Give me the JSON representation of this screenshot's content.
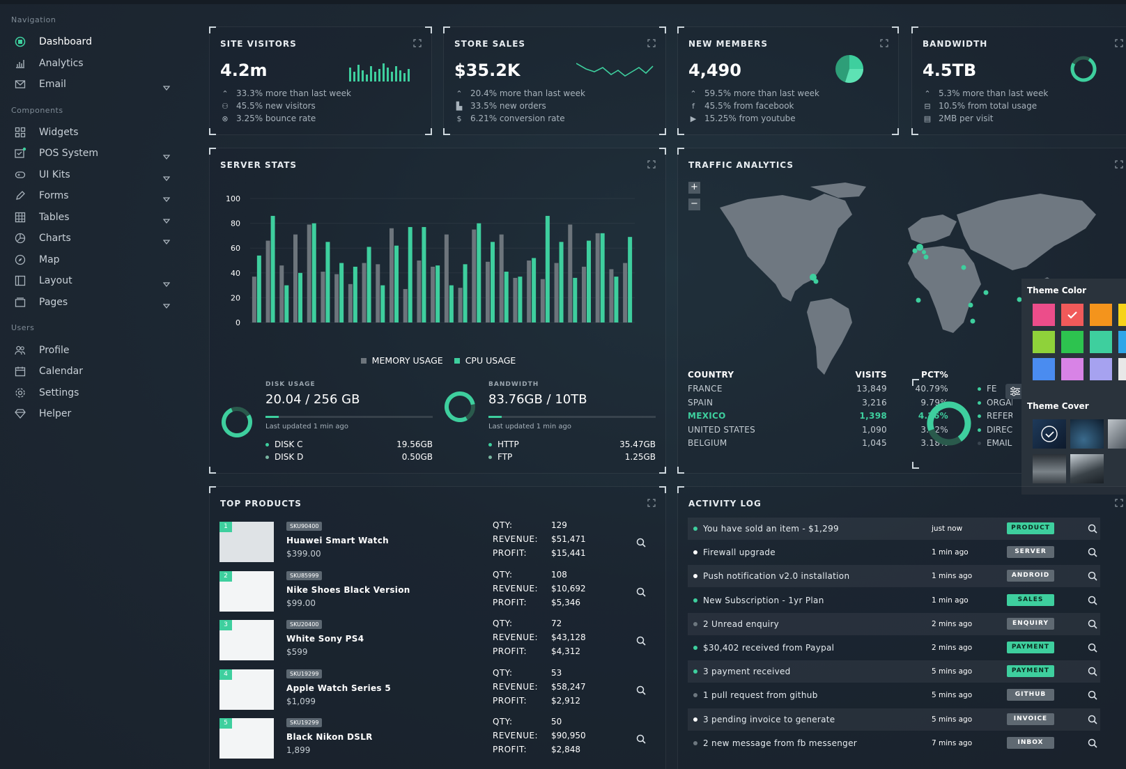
{
  "nav": {
    "section_navigation": "Navigation",
    "section_components": "Components",
    "section_users": "Users",
    "items": [
      {
        "label": "Dashboard"
      },
      {
        "label": "Analytics"
      },
      {
        "label": "Email"
      },
      {
        "label": "Widgets"
      },
      {
        "label": "POS System"
      },
      {
        "label": "UI Kits"
      },
      {
        "label": "Forms"
      },
      {
        "label": "Tables"
      },
      {
        "label": "Charts"
      },
      {
        "label": "Map"
      },
      {
        "label": "Layout"
      },
      {
        "label": "Pages"
      },
      {
        "label": "Profile"
      },
      {
        "label": "Calendar"
      },
      {
        "label": "Settings"
      },
      {
        "label": "Helper"
      }
    ]
  },
  "kpis": [
    {
      "title": "SITE VISITORS",
      "value": "4.2m",
      "lines": [
        "33.3% more than last week",
        "45.5% new visitors",
        "3.25% bounce rate"
      ]
    },
    {
      "title": "STORE SALES",
      "value": "$35.2K",
      "lines": [
        "20.4% more than last week",
        "33.5% new orders",
        "6.21% conversion rate"
      ]
    },
    {
      "title": "NEW MEMBERS",
      "value": "4,490",
      "lines": [
        "59.5% more than last week",
        "45.5% from facebook",
        "15.25% from youtube"
      ]
    },
    {
      "title": "BANDWIDTH",
      "value": "4.5TB",
      "lines": [
        "5.3% more than last week",
        "10.5% from total usage",
        "2MB per visit"
      ]
    }
  ],
  "server": {
    "title": "SERVER STATS",
    "legend_memory": "MEMORY USAGE",
    "legend_cpu": "CPU USAGE",
    "disk": {
      "label": "DISK USAGE",
      "value": "20.04 / 256 GB",
      "updated": "Last updated 1 min ago",
      "progress": 0.08,
      "rows": [
        {
          "name": "DISK C",
          "value": "19.56GB"
        },
        {
          "name": "DISK D",
          "value": "0.50GB"
        }
      ]
    },
    "bandwidth": {
      "label": "BANDWIDTH",
      "value": "83.76GB / 10TB",
      "updated": "Last updated 1 min ago",
      "progress": 0.08,
      "rows": [
        {
          "name": "HTTP",
          "value": "35.47GB"
        },
        {
          "name": "FTP",
          "value": "1.25GB"
        }
      ]
    }
  },
  "chart_data": {
    "type": "bar",
    "title": "SERVER STATS",
    "ylim": [
      0,
      100
    ],
    "yticks": [
      0,
      20,
      40,
      60,
      80,
      100
    ],
    "series": [
      {
        "name": "MEMORY USAGE",
        "color": "#6d757c",
        "values": [
          37,
          66,
          46,
          71,
          79,
          41,
          39,
          31,
          48,
          47,
          76,
          27,
          50,
          45,
          71,
          28,
          75,
          49,
          71,
          36,
          50,
          35,
          48,
          79,
          45,
          72,
          43,
          48
        ]
      },
      {
        "name": "CPU USAGE",
        "color": "#3ecf9e",
        "values": [
          54,
          86,
          30,
          40,
          80,
          65,
          48,
          45,
          61,
          30,
          62,
          77,
          77,
          46,
          30,
          47,
          80,
          65,
          41,
          37,
          52,
          86,
          65,
          36,
          66,
          72,
          37,
          69
        ]
      }
    ]
  },
  "traffic": {
    "title": "TRAFFIC ANALYTICS",
    "zoom_in": "+",
    "zoom_out": "−",
    "headers": [
      "COUNTRY",
      "VISITS",
      "PCT%"
    ],
    "rows": [
      {
        "country": "FRANCE",
        "visits": "13,849",
        "pct": "40.79%"
      },
      {
        "country": "SPAIN",
        "visits": "3,216",
        "pct": "9.79%"
      },
      {
        "country": "MEXICO",
        "visits": "1,398",
        "pct": "4.26%"
      },
      {
        "country": "UNITED STATES",
        "visits": "1,090",
        "pct": "3.32%"
      },
      {
        "country": "BELGIUM",
        "visits": "1,045",
        "pct": "3.18%"
      }
    ],
    "sources": [
      "FE",
      "ORGAN",
      "REFERR",
      "DIRECT",
      "EMAIL"
    ]
  },
  "theme": {
    "color_label": "Theme Color",
    "cover_label": "Theme Cover",
    "colors": [
      "#ec4d8a",
      "#f05a5a",
      "#f4941c",
      "#f6d31a",
      "#8fd23a",
      "#2dc34f",
      "#3ecf9e",
      "#2fa6e8",
      "#4a8cf0",
      "#d883e6",
      "#a6a2f0",
      "#e8e8e8"
    ]
  },
  "products": {
    "title": "TOP PRODUCTS",
    "qty_label": "QTY:",
    "revenue_label": "REVENUE:",
    "profit_label": "PROFIT:",
    "items": [
      {
        "rank": "1",
        "sku": "SKU90400",
        "name": "Huawei Smart Watch",
        "price": "$399.00",
        "qty": "129",
        "revenue": "$51,471",
        "profit": "$15,441"
      },
      {
        "rank": "2",
        "sku": "SKU85999",
        "name": "Nike Shoes Black Version",
        "price": "$99.00",
        "qty": "108",
        "revenue": "$10,692",
        "profit": "$5,346"
      },
      {
        "rank": "3",
        "sku": "SKU20400",
        "name": "White Sony PS4",
        "price": "$599",
        "qty": "72",
        "revenue": "$43,128",
        "profit": "$4,312"
      },
      {
        "rank": "4",
        "sku": "SKU19299",
        "name": "Apple Watch Series 5",
        "price": "$1,099",
        "qty": "53",
        "revenue": "$58,247",
        "profit": "$2,912"
      },
      {
        "rank": "5",
        "sku": "SKU19299",
        "name": "Black Nikon DSLR",
        "price": "1,899",
        "qty": "50",
        "revenue": "$90,950",
        "profit": "$2,848"
      }
    ]
  },
  "activity": {
    "title": "ACTIVITY LOG",
    "items": [
      {
        "text": "You have sold an item - $1,299",
        "time": "just now",
        "badge": "PRODUCT",
        "badge_style": "green",
        "dot": "green"
      },
      {
        "text": "Firewall upgrade",
        "time": "1 min ago",
        "badge": "SERVER",
        "badge_style": "gray",
        "dot": "white"
      },
      {
        "text": "Push notification v2.0 installation",
        "time": "1 mins ago",
        "badge": "ANDROID",
        "badge_style": "gray",
        "dot": "white"
      },
      {
        "text": "New Subscription - 1yr Plan",
        "time": "1 min ago",
        "badge": "SALES",
        "badge_style": "green",
        "dot": "green"
      },
      {
        "text": "2 Unread enquiry",
        "time": "2 mins ago",
        "badge": "ENQUIRY",
        "badge_style": "gray",
        "dot": "gray"
      },
      {
        "text": "$30,402 received from Paypal",
        "time": "2 mins ago",
        "badge": "PAYMENT",
        "badge_style": "green",
        "dot": "green"
      },
      {
        "text": "3 payment received",
        "time": "5 mins ago",
        "badge": "PAYMENT",
        "badge_style": "green",
        "dot": "green"
      },
      {
        "text": "1 pull request from github",
        "time": "5 mins ago",
        "badge": "GITHUB",
        "badge_style": "gray",
        "dot": "gray"
      },
      {
        "text": "3 pending invoice to generate",
        "time": "5 mins ago",
        "badge": "INVOICE",
        "badge_style": "gray",
        "dot": "white"
      },
      {
        "text": "2 new message from fb messenger",
        "time": "7 mins ago",
        "badge": "INBOX",
        "badge_style": "gray",
        "dot": "gray"
      }
    ]
  }
}
